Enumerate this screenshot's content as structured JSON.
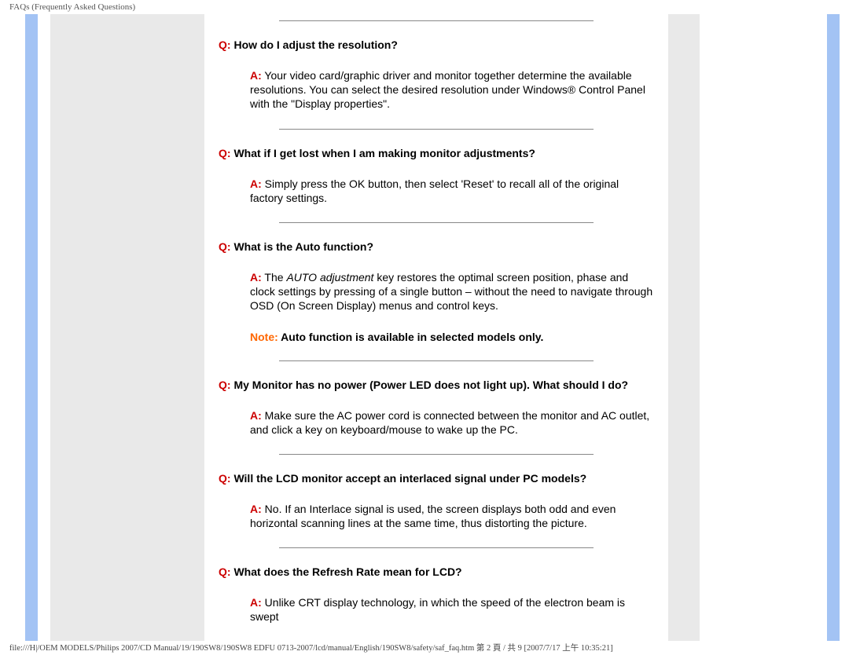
{
  "header": {
    "title": "FAQs (Frequently Asked Questions)"
  },
  "labels": {
    "q": "Q:",
    "a": "A:",
    "note": "Note:"
  },
  "faq": [
    {
      "q": "How do I adjust the resolution?",
      "a": "Your video card/graphic driver and monitor together determine the available resolutions. You can select the desired resolution under Windows® Control Panel with the \"Display properties\"."
    },
    {
      "q": "What if I get lost when I am making monitor adjustments?",
      "a": "Simply press the OK button, then select 'Reset' to recall all of the original factory settings."
    },
    {
      "q": "What is the Auto function?",
      "a_parts": {
        "pre": "The ",
        "ital": "AUTO adjustment",
        "post": " key restores the optimal screen position, phase and clock settings by pressing of a single button – without the need to navigate through OSD (On Screen Display) menus and control keys."
      },
      "note": "Auto function is available in selected models only."
    },
    {
      "q": "My Monitor has no power (Power LED does not light up). What should I do?",
      "a": "Make sure the AC power cord is connected between the monitor and AC outlet, and click a key on keyboard/mouse to wake up the PC."
    },
    {
      "q": "Will the LCD monitor accept an interlaced signal under PC models?",
      "a": "No. If an Interlace signal is used, the screen displays both odd and even horizontal scanning lines at the same time, thus distorting the picture."
    },
    {
      "q": "What does the Refresh Rate mean for LCD?",
      "a": "Unlike CRT display technology, in which the speed of the electron beam is swept"
    }
  ],
  "footer": {
    "text": "file:///H|/OEM MODELS/Philips 2007/CD Manual/19/190SW8/190SW8 EDFU 0713-2007/lcd/manual/English/190SW8/safety/saf_faq.htm 第 2 頁 / 共 9 [2007/7/17 上午 10:35:21]"
  }
}
